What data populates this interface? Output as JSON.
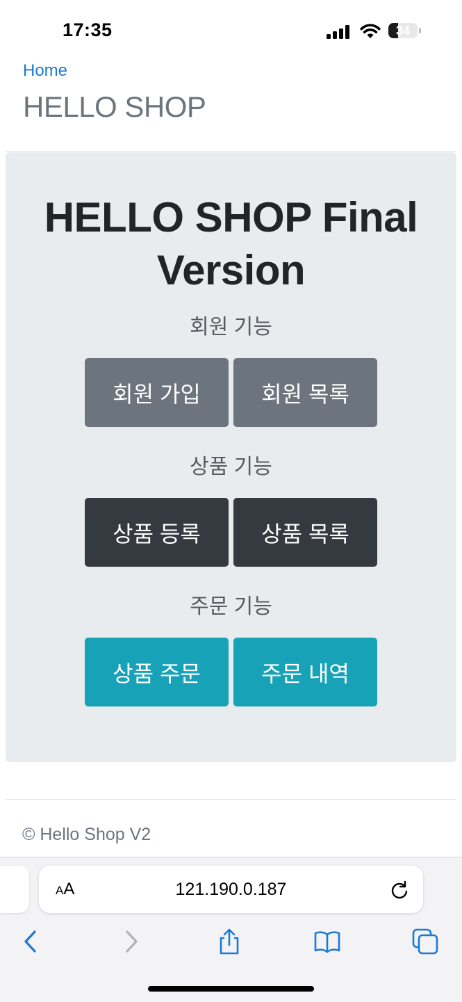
{
  "status_bar": {
    "time": "17:35",
    "battery": "34",
    "battery_level": 0.34
  },
  "nav": {
    "home_link": "Home",
    "site_title": "HELLO SHOP"
  },
  "jumbotron": {
    "title_line1": "HELLO SHOP Final",
    "title_line2": "Version",
    "sections": [
      {
        "label": "회원 기능",
        "buttons": [
          "회원 가입",
          "회원 목록"
        ],
        "color": "#6c757d"
      },
      {
        "label": "상품 기능",
        "buttons": [
          "상품 등록",
          "상품 목록"
        ],
        "color": "#343a40"
      },
      {
        "label": "주문 기능",
        "buttons": [
          "상품 주문",
          "주문 내역"
        ],
        "color": "#17a2b8"
      }
    ]
  },
  "footer": {
    "text": "© Hello Shop V2"
  },
  "browser": {
    "text_size_button": "AA",
    "url": "121.190.0.187",
    "accent": "#1a7ad4",
    "icons": [
      "back-icon",
      "forward-icon",
      "share-icon",
      "bookmarks-icon",
      "tabs-icon",
      "reload-icon"
    ]
  }
}
